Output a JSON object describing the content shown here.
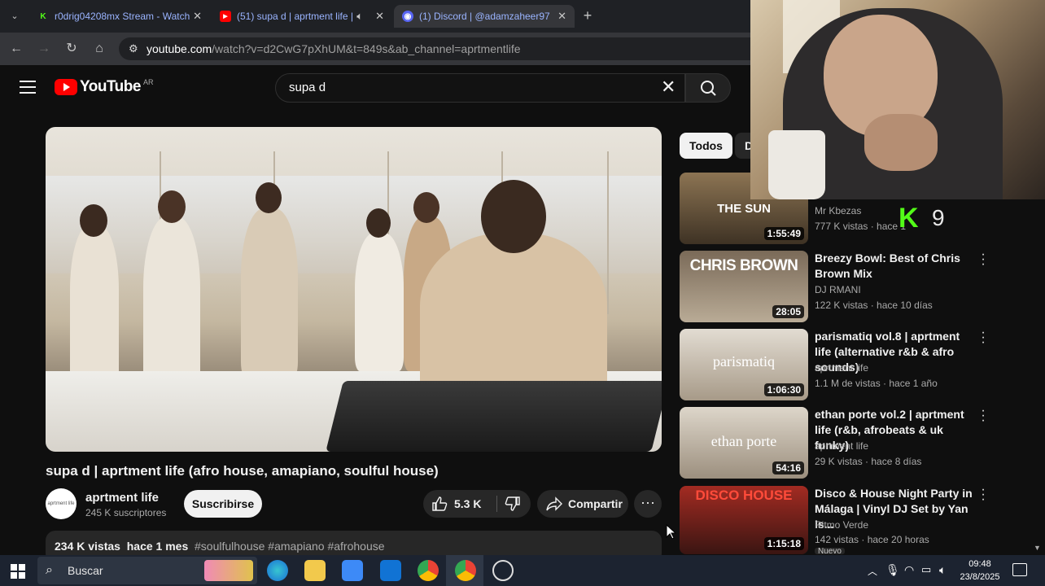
{
  "browser": {
    "tabs": [
      {
        "title": "r0drig04208mx Stream - Watch",
        "favicon": "kick-icon",
        "color": "#53fc18"
      },
      {
        "title": "(51) supa d | aprtment life |",
        "favicon": "youtube-icon",
        "color": "#ff0000"
      },
      {
        "title": "(1) Discord | @adamzaheer97",
        "favicon": "discord-icon",
        "color": "#5865f2"
      }
    ],
    "new_tab": "+",
    "url_host": "youtube.com",
    "url_path": "/watch?v=d2CwG7pXhUM&t=849s&ab_channel=aprtmentlife"
  },
  "youtube": {
    "logo_text": "YouTube",
    "country": "AR",
    "search_value": "supa d"
  },
  "video": {
    "title": "supa d | aprtment life (afro house, amapiano, soulful house)",
    "channel": "aprtment life",
    "subscribers": "245 K suscriptores",
    "avatar_text": "aprtment life",
    "subscribe_label": "Suscribirse",
    "likes": "5.3 K",
    "share_label": "Compartir",
    "more": "···",
    "views": "234 K vistas",
    "age": "hace 1 mes",
    "tags": "#soulfulhouse #amapiano #afrohouse"
  },
  "chips": [
    "Todos",
    "D"
  ],
  "recommendations": [
    {
      "thumb_text": "THE SUN",
      "duration": "1:55:49",
      "title": "",
      "channel": "Mr Kbezas",
      "meta": "777 K vistas · hace 1",
      "bg": "#5d4a33"
    },
    {
      "thumb_text": "CHRIS BROWN",
      "duration": "28:05",
      "title": "Breezy Bowl: Best of Chris Brown Mix",
      "channel": "DJ RMANI",
      "meta": "122 K vistas · hace 10 días",
      "bg": "#6f5a44"
    },
    {
      "thumb_text": "parismatiq",
      "duration": "1:06:30",
      "title": "parismatiq vol.8 | aprtment life (alternative r&b & afro sounds)",
      "channel": "aprtment life",
      "meta": "1.1 M de vistas · hace 1 año",
      "bg": "#c9bfb0"
    },
    {
      "thumb_text": "ethan porte",
      "duration": "54:16",
      "title": "ethan porte vol.2 | aprtment life (r&b, afrobeats & uk funky)",
      "channel": "aprtment life",
      "meta": "29 K vistas · hace 8 días",
      "bg": "#c2b8a8"
    },
    {
      "thumb_text": "DISCO HOUSE",
      "duration": "1:15:18",
      "title": "Disco & House Night Party in Málaga | Vinyl DJ Set by Yan Is...",
      "channel": "Ritmo Verde",
      "meta": "142 vistas · hace 20 horas",
      "badge": "Nuevo",
      "bg": "#7a1f1a"
    }
  ],
  "overlay": {
    "logo_letter": "K",
    "number": "9"
  },
  "taskbar": {
    "search_label": "Buscar",
    "time": "09:48",
    "date": "23/8/2025"
  }
}
